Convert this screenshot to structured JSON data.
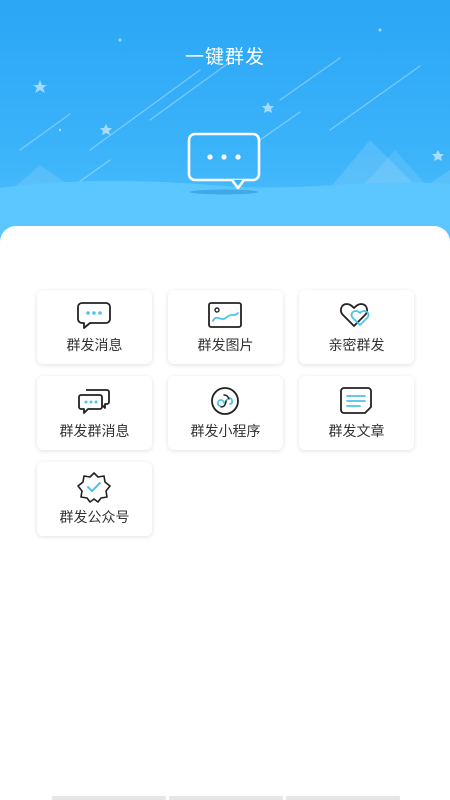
{
  "header": {
    "title": "一键群发",
    "background_color": "#3bb3fa"
  },
  "hero": {
    "icon": "chat-bubble-ellipsis-icon"
  },
  "grid": {
    "items": [
      {
        "label": "群发消息",
        "icon": "chat-bubble-icon"
      },
      {
        "label": "群发图片",
        "icon": "image-icon"
      },
      {
        "label": "亲密群发",
        "icon": "hearts-icon"
      },
      {
        "label": "群发群消息",
        "icon": "group-chat-icon"
      },
      {
        "label": "群发小程序",
        "icon": "mini-program-icon"
      },
      {
        "label": "群发文章",
        "icon": "article-icon"
      },
      {
        "label": "群发公众号",
        "icon": "official-account-icon"
      }
    ]
  },
  "colors": {
    "accent": "#3bb3fa",
    "icon_dark": "#222222",
    "icon_highlight": "#4ec3ea"
  }
}
